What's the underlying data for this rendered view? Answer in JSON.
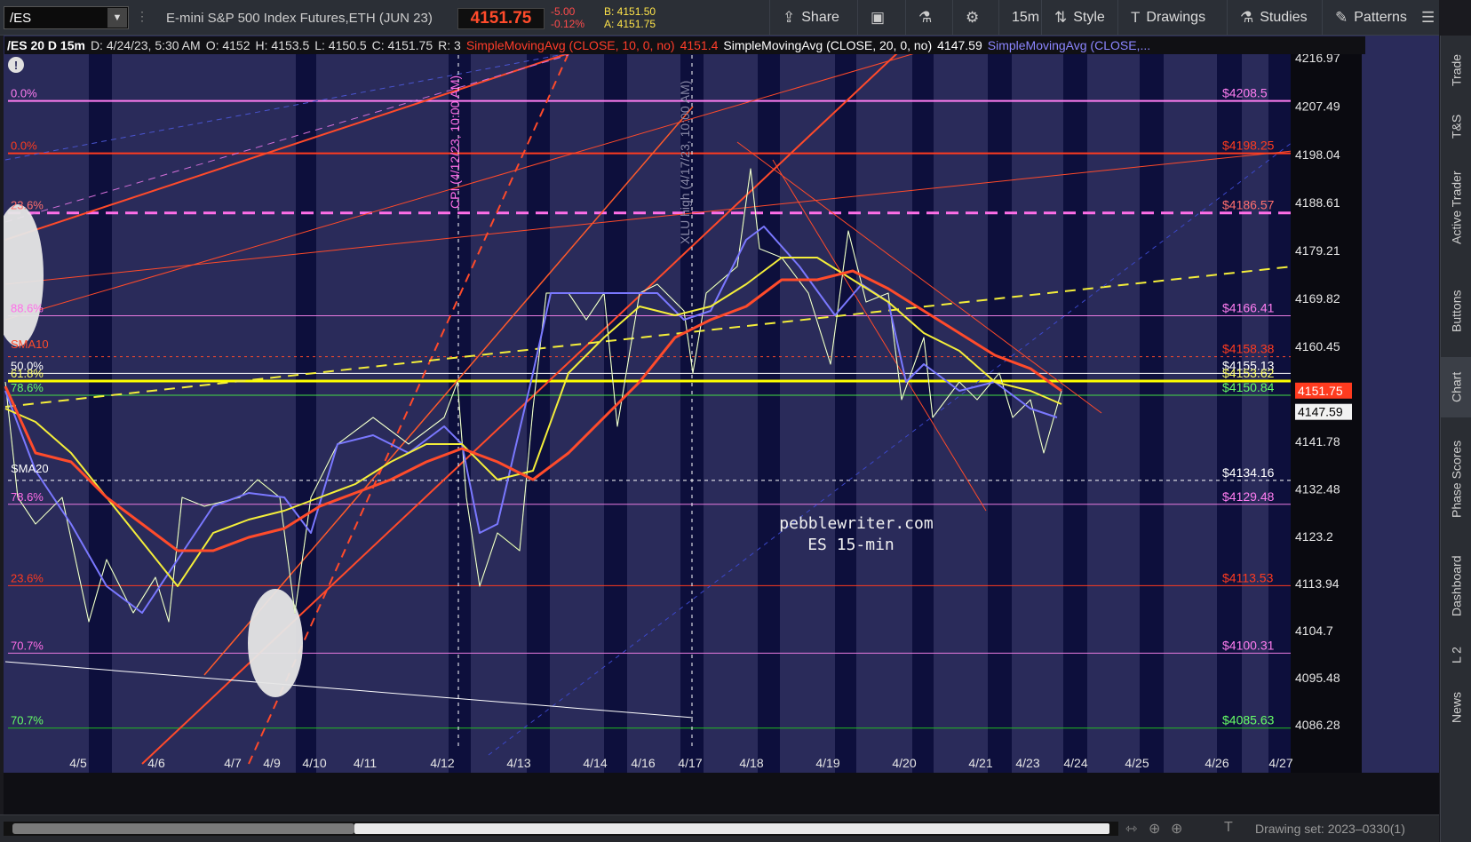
{
  "toolbar": {
    "symbol": "/ES",
    "description": "E-mini S&P 500 Index Futures,ETH (JUN 23)",
    "last_price": "4151.75",
    "change": "-5.00",
    "change_pct": "-0.12%",
    "bid": "B: 4151.50",
    "ask": "A: 4151.75",
    "share_label": "Share",
    "timeframe_label": "15m",
    "style_label": "Style",
    "drawings_label": "Drawings",
    "studies_label": "Studies",
    "patterns_label": "Patterns"
  },
  "side_tabs": [
    "Trade",
    "T&S",
    "Active Trader",
    "Buttons",
    "Chart",
    "Phase Scores",
    "Dashboard",
    "L 2",
    "News"
  ],
  "infobar": {
    "title": "/ES 20 D 15m",
    "date": "D: 4/24/23, 5:30 AM",
    "open": "O: 4152",
    "high": "H: 4153.5",
    "low": "L: 4150.5",
    "close": "C: 4151.75",
    "range": "R: 3",
    "sma10_label": "SimpleMovingAvg (CLOSE, 10, 0, no)",
    "sma10_value": "4151.4",
    "sma20_label": "SimpleMovingAvg (CLOSE, 20, 0, no)",
    "sma20_value": "4147.59",
    "sma3_label": "SimpleMovingAvg (CLOSE,..."
  },
  "price_axis": [
    "4216.97",
    "4207.49",
    "4198.04",
    "4188.61",
    "4179.21",
    "4169.82",
    "4160.45",
    "4151.75",
    "4141.78",
    "4132.48",
    "4123.2",
    "4113.94",
    "4104.7",
    "4095.48",
    "4086.28"
  ],
  "price_badges": {
    "last": "4151.75",
    "sma": "4147.59"
  },
  "date_axis": [
    "4/5",
    "4/6",
    "4/7",
    "4/9",
    "4/10",
    "4/11",
    "4/12",
    "4/13",
    "4/14",
    "4/16",
    "4/17",
    "4/18",
    "4/19",
    "4/20",
    "4/21",
    "4/23",
    "4/24",
    "4/25",
    "4/26",
    "4/27"
  ],
  "level_labels": [
    "$4208.5",
    "$4198.25",
    "$4186.57",
    "$4166.41",
    "$4158.38",
    "$4155.13",
    "$4153.62",
    "$4150.84",
    "$4134.16",
    "$4129.48",
    "$4113.53",
    "$4100.31",
    "$4085.63"
  ],
  "fib_labels": [
    "0.0%",
    "0.0%",
    "23.6%",
    "88.6%",
    "50.0%",
    "61.8%",
    "78.6%",
    "78.6%",
    "23.6%",
    "70.7%",
    "70.7%"
  ],
  "ma_labels": {
    "sma10": "SMA10",
    "sma20": "SMA20"
  },
  "vertical_annotations": {
    "cpi": "CPI (4/12/23, 10:00 AM)",
    "xlu": "XLU high (4/17/23, 10:00 AM)"
  },
  "watermark": {
    "site": "pebblewriter.com",
    "sub": "ES 15-min"
  },
  "bottom": {
    "drawing_set": "Drawing set: 2023–0330(1)"
  },
  "colors": {
    "background": "#2a2b5a",
    "band": "#0d0f3c",
    "price_red": "#ff4b2b",
    "sma_yellow": "#f4ee3a",
    "sma_blue": "#7a78ff",
    "magenta": "#ff6ee8"
  }
}
